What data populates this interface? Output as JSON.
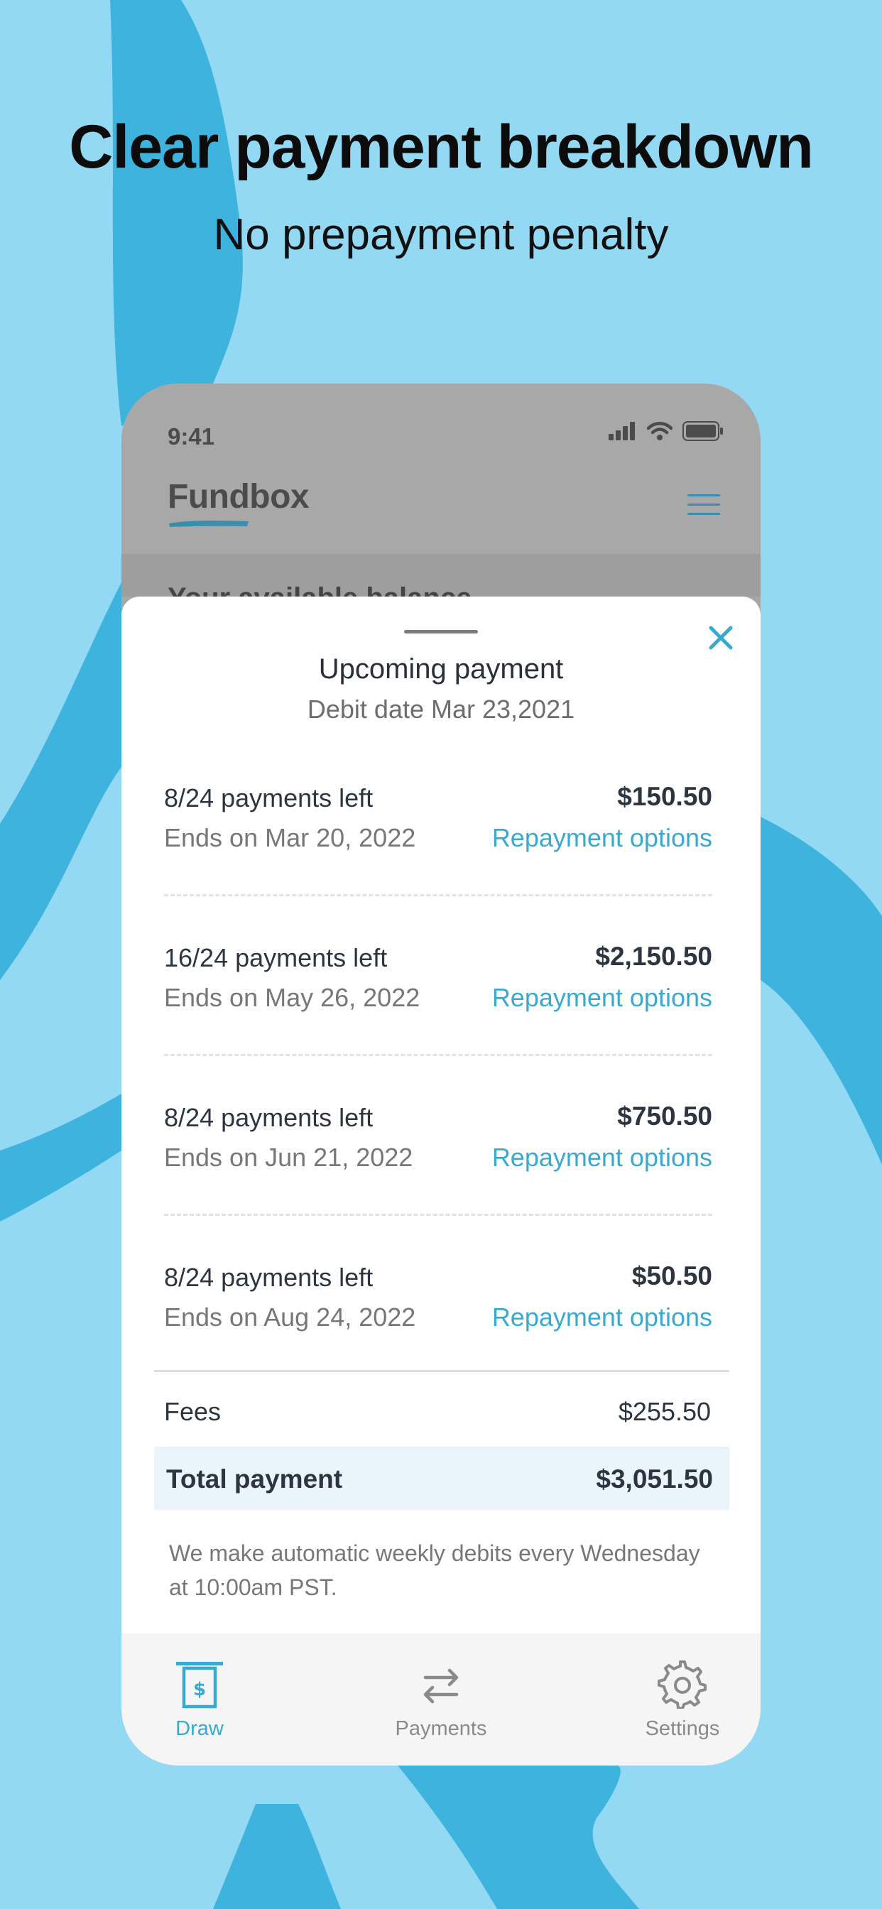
{
  "headline": "Clear payment breakdown",
  "subheadline": "No prepayment penalty",
  "colors": {
    "background": "#94d9f3",
    "swoosh": "#3eb3de",
    "accent": "#3aa9cf"
  },
  "status_bar": {
    "time": "9:41"
  },
  "app": {
    "logo": "Fundbox",
    "background_partial_text": "Your available balance"
  },
  "sheet": {
    "title": "Upcoming payment",
    "subtitle": "Debit date Mar 23,2021",
    "loans": [
      {
        "payments_left": "8/24 payments left",
        "ends": "Ends on Mar 20, 2022",
        "amount": "$150.50",
        "link": "Repayment options"
      },
      {
        "payments_left": "16/24 payments left",
        "ends": "Ends on May 26, 2022",
        "amount": "$2,150.50",
        "link": "Repayment options"
      },
      {
        "payments_left": "8/24 payments left",
        "ends": "Ends on Jun 21, 2022",
        "amount": "$750.50",
        "link": "Repayment options"
      },
      {
        "payments_left": "8/24 payments left",
        "ends": "Ends on Aug 24, 2022",
        "amount": "$50.50",
        "link": "Repayment options"
      }
    ],
    "fees_label": "Fees",
    "fees_value": "$255.50",
    "total_label": "Total payment",
    "total_value": "$3,051.50",
    "note": "We make automatic weekly debits every Wednesday at 10:00am PST."
  },
  "tabs": [
    {
      "label": "Draw",
      "icon": "draw-icon",
      "active": true
    },
    {
      "label": "Payments",
      "icon": "transfer-arrows-icon",
      "active": false
    },
    {
      "label": "Settings",
      "icon": "gear-icon",
      "active": false
    }
  ]
}
